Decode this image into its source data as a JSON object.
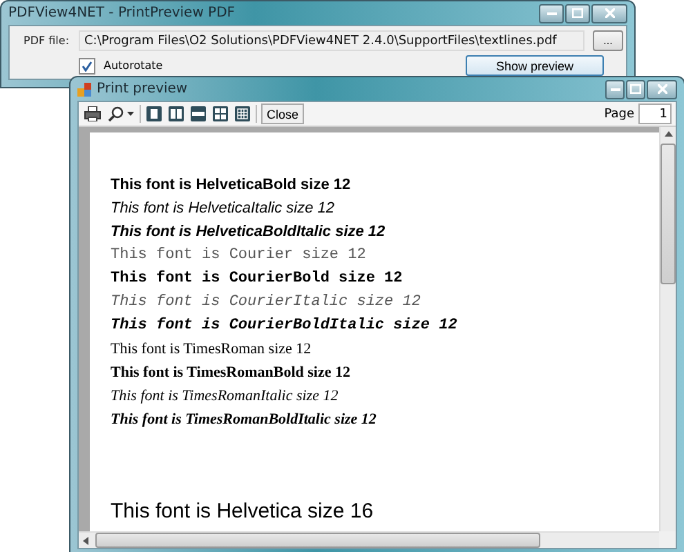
{
  "main_window": {
    "title": "PDFView4NET - PrintPreview PDF",
    "file_label": "PDF file:",
    "file_path": "C:\\Program Files\\O2 Solutions\\PDFView4NET 2.4.0\\SupportFiles\\textlines.pdf",
    "browse_button": "...",
    "autorotate": {
      "label": "Autorotate",
      "checked": true
    },
    "show_preview_button": "Show preview"
  },
  "preview_window": {
    "title": "Print preview",
    "close_button": "Close",
    "page_label": "Page",
    "page_value": "1",
    "lines": [
      {
        "text": "This font is HelveticaBold size 12",
        "kind": "sansbold"
      },
      {
        "text": "This font is HelveticaItalic size 12",
        "kind": "sansitalic"
      },
      {
        "text": "This font is HelveticaBoldItalic size 12",
        "kind": "sansbolditalic"
      },
      {
        "text": "This font is Courier size 12",
        "kind": "mono"
      },
      {
        "text": "This font is CourierBold size 12",
        "kind": "monobold"
      },
      {
        "text": "This font is CourierItalic size 12",
        "kind": "monoitalic"
      },
      {
        "text": "This font is CourierBoldItalic size 12",
        "kind": "monobolditalic"
      },
      {
        "text": "This font is TimesRoman size 12",
        "kind": "serif"
      },
      {
        "text": "This font is TimesRomanBold size 12",
        "kind": "serifbold"
      },
      {
        "text": "This font is TimesRomanItalic size 12",
        "kind": "serifitalic"
      },
      {
        "text": "This font is TimesRomanBoldItalic size 12",
        "kind": "serifbolditalic"
      },
      {
        "text": "This font is Helvetica size 16",
        "kind": "sanslarge"
      }
    ]
  }
}
